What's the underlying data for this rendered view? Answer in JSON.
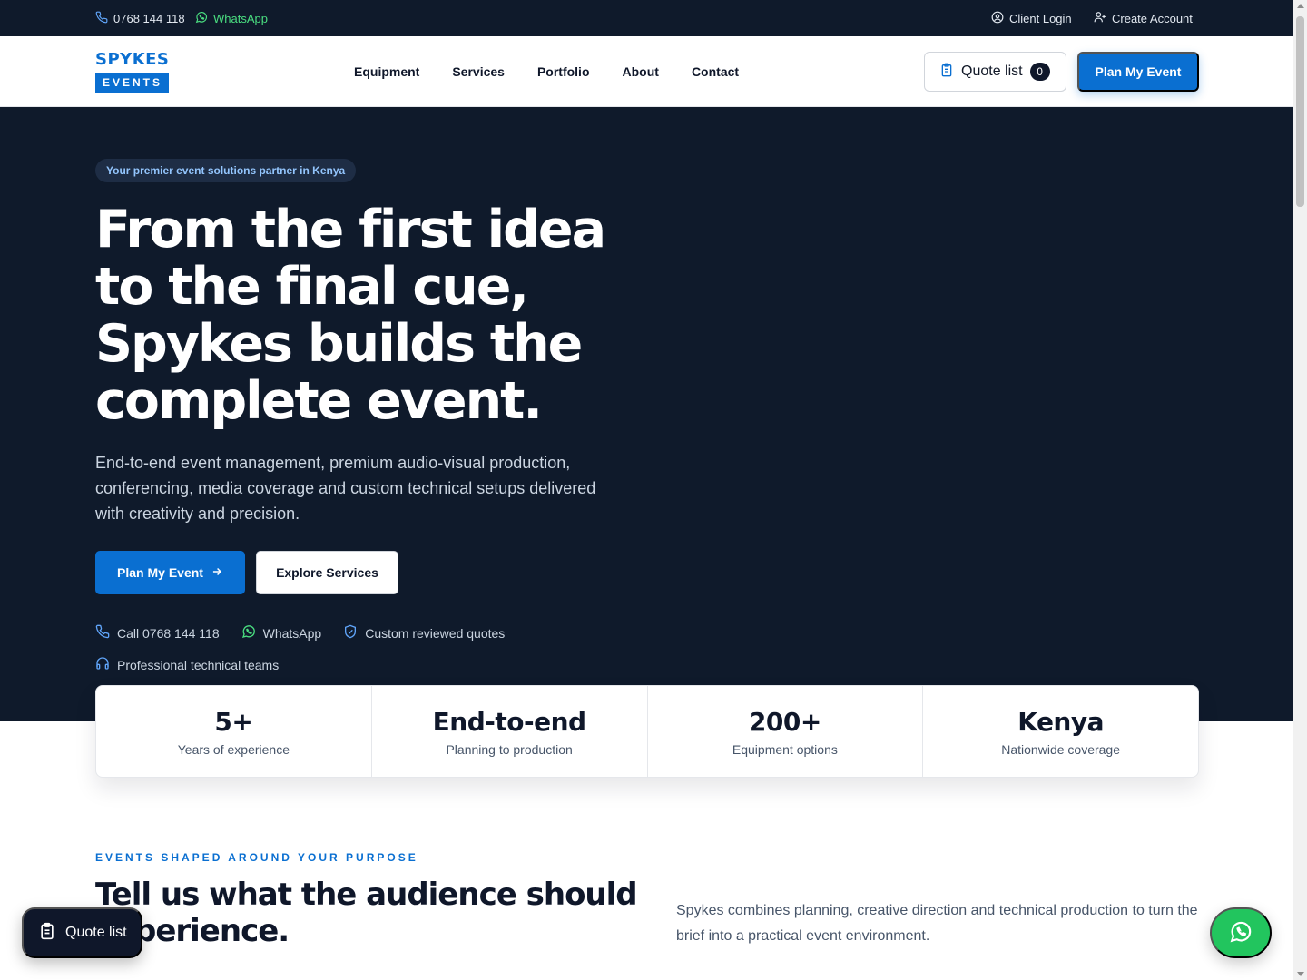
{
  "topbar": {
    "phone": "0768 144 118",
    "whatsapp": "WhatsApp",
    "client_login": "Client Login",
    "create_account": "Create Account"
  },
  "header": {
    "logo_top": "SPYKES",
    "logo_bottom": "EVENTS",
    "nav": [
      "Equipment",
      "Services",
      "Portfolio",
      "About",
      "Contact"
    ],
    "quote_label": "Quote list",
    "quote_count": "0",
    "plan_label": "Plan My Event"
  },
  "hero": {
    "pill": "Your premier event solutions partner in Kenya",
    "title": "From the first idea to the final cue, Spykes builds the complete event.",
    "description": "End-to-end event management, premium audio-visual production, conferencing, media coverage and custom technical setups delivered with creativity and precision.",
    "primary_cta": "Plan My Event",
    "secondary_cta": "Explore Services",
    "features": [
      {
        "icon": "phone-icon",
        "label": "Call 0768 144 118"
      },
      {
        "icon": "whatsapp-icon",
        "label": "WhatsApp"
      },
      {
        "icon": "shield-check-icon",
        "label": "Custom reviewed quotes"
      },
      {
        "icon": "headphones-icon",
        "label": "Professional technical teams"
      }
    ]
  },
  "stats": [
    {
      "value": "5+",
      "label": "Years of experience"
    },
    {
      "value": "End-to-end",
      "label": "Planning to production"
    },
    {
      "value": "200+",
      "label": "Equipment options"
    },
    {
      "value": "Kenya",
      "label": "Nationwide coverage"
    }
  ],
  "section": {
    "eyebrow": "EVENTS SHAPED AROUND YOUR PURPOSE",
    "title": "Tell us what the audience should experience.",
    "description": "Spykes combines planning, creative direction and technical production to turn the brief into a practical event environment."
  },
  "floating": {
    "quote_label": "Quote list"
  },
  "colors": {
    "brand": "#0a6fd1",
    "navy": "#0f1a2b",
    "whatsapp": "#22c55e"
  }
}
